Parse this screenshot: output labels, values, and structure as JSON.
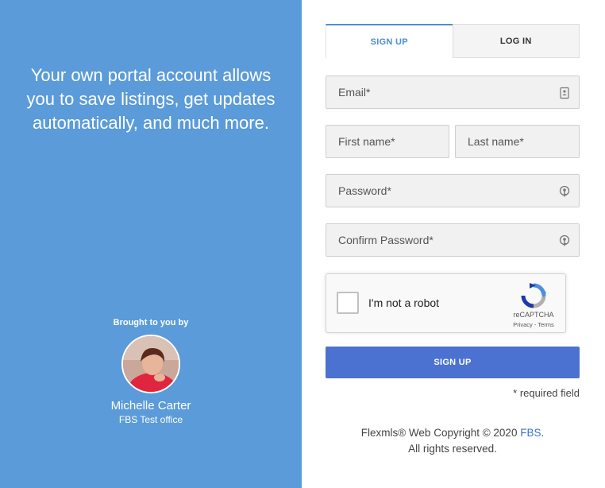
{
  "left": {
    "tagline": "Your own portal account allows you to save listings, get updates automatically, and much more.",
    "brought_by": "Brought to you by",
    "agent_name": "Michelle Carter",
    "agent_office": "FBS Test office",
    "panel_color": "#5b9bd9"
  },
  "tabs": {
    "signup": "SIGN UP",
    "login": "LOG IN"
  },
  "form": {
    "email_placeholder": "Email*",
    "first_name_placeholder": "First name*",
    "last_name_placeholder": "Last name*",
    "password_placeholder": "Password*",
    "confirm_password_placeholder": "Confirm Password*",
    "captcha_label": "I'm not a robot",
    "captcha_brand": "reCAPTCHA",
    "captcha_privacy": "Privacy",
    "captcha_separator": " - ",
    "captcha_terms": "Terms",
    "submit_label": "SIGN UP",
    "required_note": "* required field",
    "accent_color": "#4b72d0"
  },
  "footer": {
    "copyright_prefix": "Flexmls® Web Copyright © 2020 ",
    "fbs_link": "FBS",
    "period": ".",
    "rights": "All rights reserved."
  }
}
